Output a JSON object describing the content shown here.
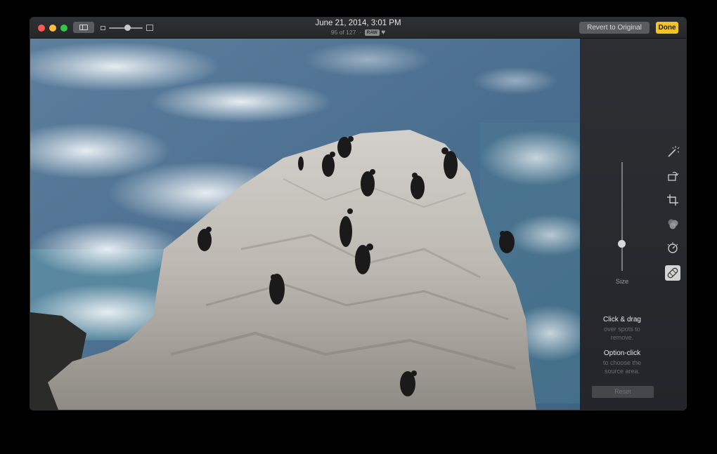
{
  "titlebar": {
    "date": "June 21, 2014, 3:01 PM",
    "counter": "95 of 127",
    "separator": "·",
    "format_badge": "RAW",
    "favorite_icon": "heart-icon",
    "revert_label": "Revert to Original",
    "done_label": "Done"
  },
  "retouch": {
    "size_label": "Size",
    "size_level": 0.25,
    "hint1_title": "Click & drag",
    "hint1_body": "over spots to remove.",
    "hint2_title": "Option-click",
    "hint2_body": "to choose the source area.",
    "reset_label": "Reset"
  },
  "tools": [
    {
      "name": "enhance",
      "icon": "magic-wand-icon"
    },
    {
      "name": "rotate",
      "icon": "rotate-icon"
    },
    {
      "name": "crop",
      "icon": "crop-icon"
    },
    {
      "name": "filters",
      "icon": "filters-icon"
    },
    {
      "name": "adjust",
      "icon": "adjust-dial-icon"
    },
    {
      "name": "retouch",
      "icon": "bandage-icon",
      "active": true
    }
  ],
  "colors": {
    "done_accent": "#f4c325",
    "close": "#fc5753",
    "minimize": "#fdbc40",
    "maximize": "#33c748"
  }
}
